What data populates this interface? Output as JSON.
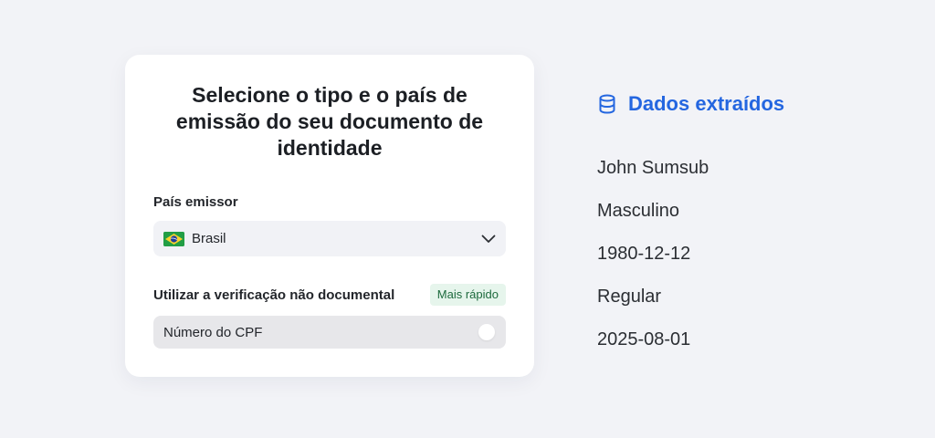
{
  "card": {
    "title": "Selecione o tipo e o país de emissão do seu documento de identidade",
    "country_label": "País emissor",
    "country_value": "Brasil",
    "country_flag": "brazil-flag-icon",
    "nondoc_label": "Utilizar a verificação não documental",
    "nondoc_badge": "Mais rápido",
    "option_label": "Número do CPF",
    "option_enabled": false
  },
  "extracted": {
    "icon": "database-icon",
    "title": "Dados extraídos",
    "accent_color": "#2466e0",
    "items": [
      "John Sumsub",
      "Masculino",
      "1980-12-12",
      "Regular",
      "2025-08-01"
    ]
  }
}
